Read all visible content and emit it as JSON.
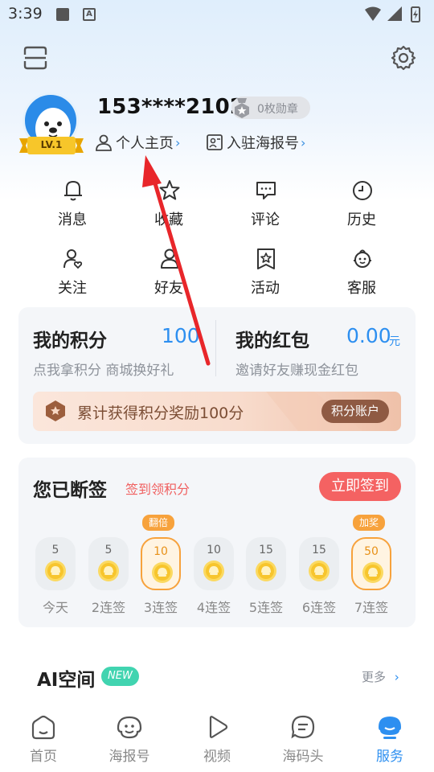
{
  "status_bar": {
    "time": "3:39",
    "a_icon": "A"
  },
  "header": {
    "menu_icon": "scan-frame-icon",
    "settings_icon": "gear-icon"
  },
  "profile": {
    "phone": "153****2102",
    "level": "LV.1",
    "medal_text": "0枚勋章",
    "profile_link": "个人主页",
    "enter_link": "入驻海报号"
  },
  "grid": [
    {
      "label": "消息",
      "icon": "bell-icon"
    },
    {
      "label": "收藏",
      "icon": "star-icon"
    },
    {
      "label": "评论",
      "icon": "comment-icon"
    },
    {
      "label": "历史",
      "icon": "clock-icon"
    },
    {
      "label": "关注",
      "icon": "follow-user-icon"
    },
    {
      "label": "好友",
      "icon": "friend-icon"
    },
    {
      "label": "活动",
      "icon": "activity-star-icon"
    },
    {
      "label": "客服",
      "icon": "service-icon"
    }
  ],
  "points": {
    "title": "我的积分",
    "value": "100",
    "subtitle": "点我拿积分 商城换好礼"
  },
  "redpacket": {
    "title": "我的红包",
    "value": "0.00",
    "unit": "元",
    "subtitle": "邀请好友赚现金红包"
  },
  "banner": {
    "text": "累计获得积分奖励100分",
    "button": "积分账户"
  },
  "sign": {
    "title": "您已断签",
    "subtitle": "签到领积分",
    "button": "立即签到",
    "days": [
      {
        "value": "5",
        "label": "今天",
        "highlight": false,
        "tag": ""
      },
      {
        "value": "5",
        "label": "2连签",
        "highlight": false,
        "tag": ""
      },
      {
        "value": "10",
        "label": "3连签",
        "highlight": true,
        "tag": "翻倍"
      },
      {
        "value": "10",
        "label": "4连签",
        "highlight": false,
        "tag": ""
      },
      {
        "value": "15",
        "label": "5连签",
        "highlight": false,
        "tag": ""
      },
      {
        "value": "15",
        "label": "6连签",
        "highlight": false,
        "tag": ""
      },
      {
        "value": "50",
        "label": "7连签",
        "highlight": true,
        "tag": "加奖"
      }
    ]
  },
  "ai": {
    "title": "AI空间",
    "badge": "NEW",
    "more": "更多"
  },
  "tabs": [
    {
      "label": "首页",
      "icon": "home-icon",
      "active": false
    },
    {
      "label": "海报号",
      "icon": "face-icon",
      "active": false
    },
    {
      "label": "视频",
      "icon": "play-icon",
      "active": false
    },
    {
      "label": "海码头",
      "icon": "chat-bubble-icon",
      "active": false
    },
    {
      "label": "服务",
      "icon": "service-avatar-icon",
      "active": true
    }
  ],
  "colors": {
    "accent": "#2d8ff0",
    "red": "#f46262",
    "orange": "#f7a23c"
  }
}
